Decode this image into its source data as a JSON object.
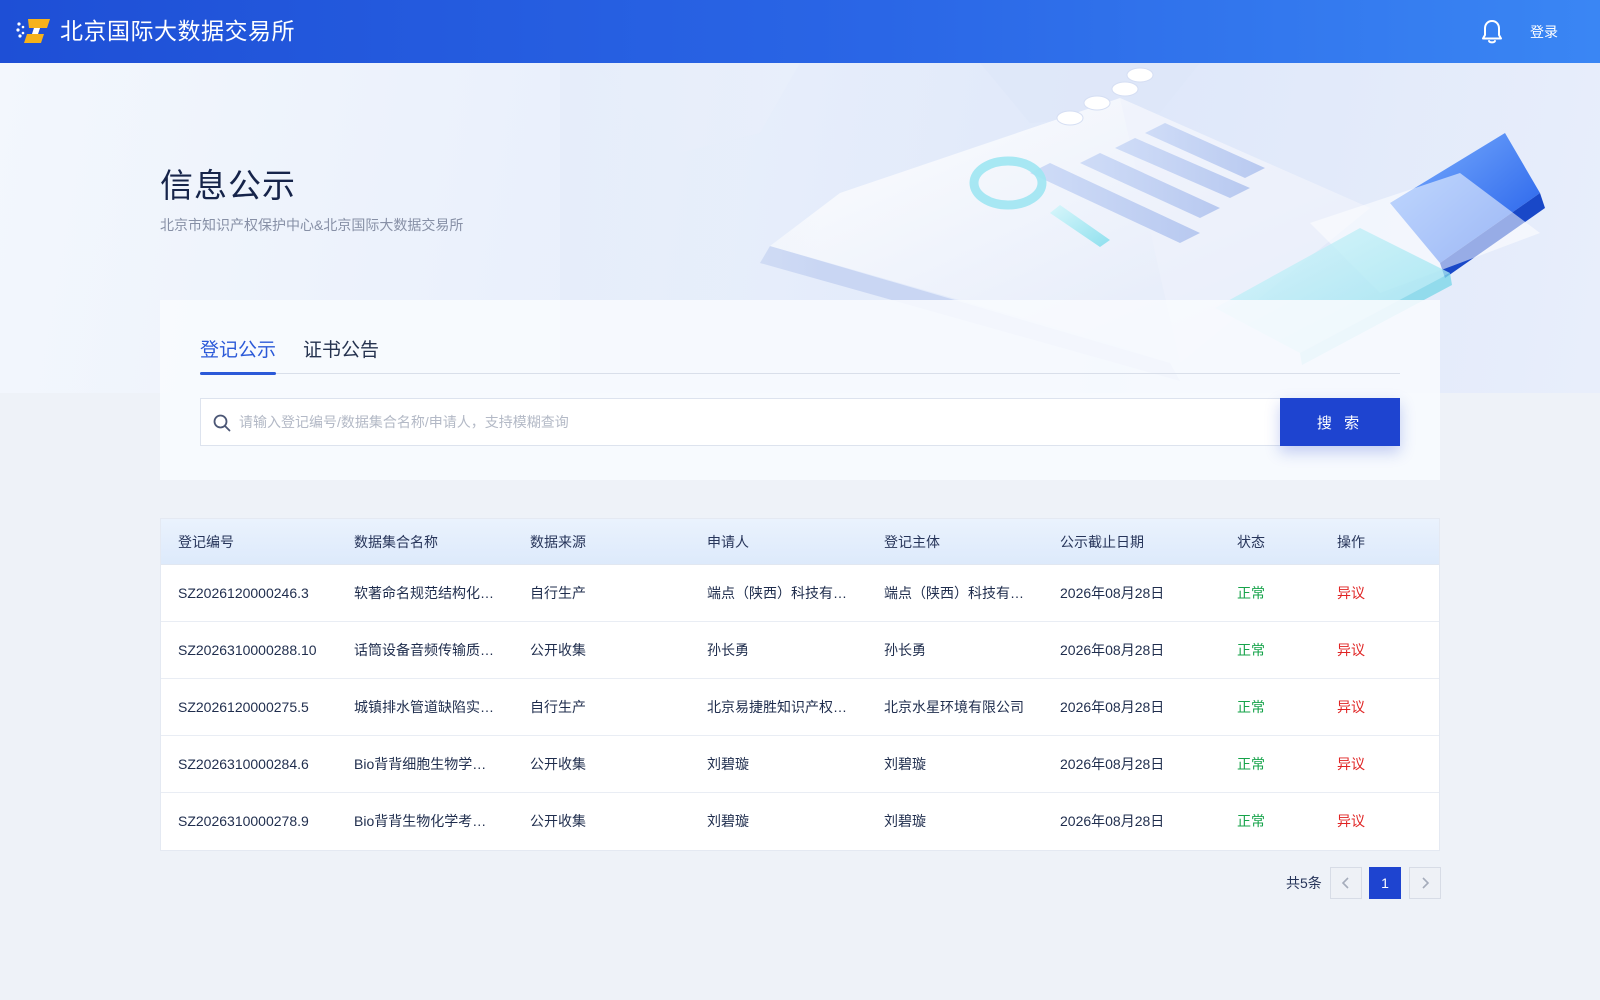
{
  "header": {
    "brand": "北京国际大数据交易所",
    "login_label": "登录",
    "icons": {
      "logo": "brand-logo",
      "notification": "bell-icon"
    }
  },
  "hero": {
    "title": "信息公示",
    "subtitle": "北京市知识产权保护中心&北京国际大数据交易所"
  },
  "tabs": [
    {
      "label": "登记公示",
      "active": true
    },
    {
      "label": "证书公告",
      "active": false
    }
  ],
  "search": {
    "placeholder": "请输入登记编号/数据集合名称/申请人，支持模糊查询",
    "value": "",
    "button_label": "搜 索"
  },
  "table": {
    "columns": [
      "登记编号",
      "数据集合名称",
      "数据来源",
      "申请人",
      "登记主体",
      "公示截止日期",
      "状态",
      "操作"
    ],
    "rows": [
      {
        "id": "SZ2026120000246.3",
        "name": "软著命名规范结构化数据集",
        "source": "自行生产",
        "applicant": "端点（陕西）科技有限公司",
        "subject": "端点（陕西）科技有限公司",
        "deadline": "2026年08月28日",
        "status": "正常",
        "action": "异议"
      },
      {
        "id": "SZ2026310000288.10",
        "name": "话筒设备音频传输质量数据集",
        "source": "公开收集",
        "applicant": "孙长勇",
        "subject": "孙长勇",
        "deadline": "2026年08月28日",
        "status": "正常",
        "action": "异议"
      },
      {
        "id": "SZ2026120000275.5",
        "name": "城镇排水管道缺陷实例数据集",
        "source": "自行生产",
        "applicant": "北京易捷胜知识产权代理有限公司",
        "subject": "北京水星环境有限公司",
        "deadline": "2026年08月28日",
        "status": "正常",
        "action": "异议"
      },
      {
        "id": "SZ2026310000284.6",
        "name": "Bio背背细胞生物学数据集",
        "source": "公开收集",
        "applicant": "刘碧璇",
        "subject": "刘碧璇",
        "deadline": "2026年08月28日",
        "status": "正常",
        "action": "异议"
      },
      {
        "id": "SZ2026310000278.9",
        "name": "Bio背背生物化学考试数据集",
        "source": "公开收集",
        "applicant": "刘碧璇",
        "subject": "刘碧璇",
        "deadline": "2026年08月28日",
        "status": "正常",
        "action": "异议"
      }
    ]
  },
  "pagination": {
    "total_label": "共5条",
    "current_page": "1"
  },
  "colors": {
    "primary": "#1e44d0",
    "status_ok": "#16a34a",
    "action_red": "#e02424",
    "header_start": "#1e4fd6",
    "header_end": "#3a86f4"
  }
}
